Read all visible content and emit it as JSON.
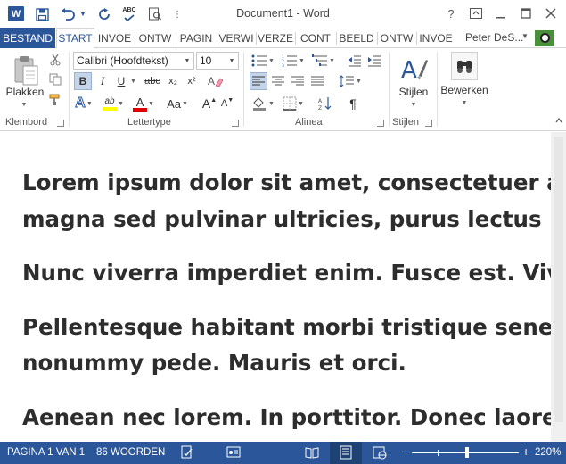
{
  "app": {
    "window_title": "Document1 - Word",
    "logo_letter": "W"
  },
  "quick_access": [
    {
      "name": "save-icon"
    },
    {
      "name": "undo-icon"
    },
    {
      "name": "redo-icon"
    },
    {
      "name": "spelling-check-icon",
      "label": "ABC"
    },
    {
      "name": "print-preview-icon"
    },
    {
      "name": "customize-toolbar-icon"
    }
  ],
  "window_controls": {
    "help": "?",
    "ribbon_display": "⧉",
    "minimize": "—",
    "maximize": "☐",
    "close": "✕"
  },
  "ribbon_tabs": {
    "file": "BESTAND",
    "tabs": [
      "START",
      "INVOE",
      "ONTW",
      "PAGIN",
      "VERWI",
      "VERZE",
      "CONT",
      "BEELD",
      "ONTW",
      "INVOE"
    ],
    "active_index": 0
  },
  "user": {
    "name": "Peter DeS..."
  },
  "ribbon": {
    "clipboard": {
      "label": "Klembord",
      "paste_label": "Plakken"
    },
    "font": {
      "label": "Lettertype",
      "font_name": "Calibri (Hoofdtekst)",
      "font_size": "10",
      "bold": "B",
      "italic": "I",
      "underline": "U",
      "strikethrough": "abc",
      "subscript": "x₂",
      "superscript": "x²",
      "grow": "A",
      "shrink": "A",
      "change_case": "Aa",
      "text_effects": "A",
      "highlight": "ab",
      "font_color": "A",
      "clear_format": "A"
    },
    "paragraph": {
      "label": "Alinea",
      "pilcrow": "¶"
    },
    "styles": {
      "label": "Stijlen",
      "styles_label": "Stijlen"
    },
    "editing": {
      "editing_label": "Bewerken"
    }
  },
  "document": {
    "paragraphs": [
      "Lorem ipsum dolor sit amet, consectetuer adipisc\nmagna sed pulvinar ultricies, purus lectus malesu",
      "Nunc viverra imperdiet enim. Fusce est. Vivamus",
      "Pellentesque habitant morbi tristique senectus e\nnonummy pede. Mauris et orci.",
      "Aenean nec lorem. In porttitor. Donec laoreet no"
    ]
  },
  "status_bar": {
    "page": "PAGINA 1 VAN 1",
    "words": "86 WOORDEN",
    "zoom_minus": "−",
    "zoom_plus": "+",
    "zoom_level": "220%"
  },
  "colors": {
    "accent": "#2b579a",
    "highlight_yellow": "#ffff00",
    "font_red": "#e00000"
  }
}
